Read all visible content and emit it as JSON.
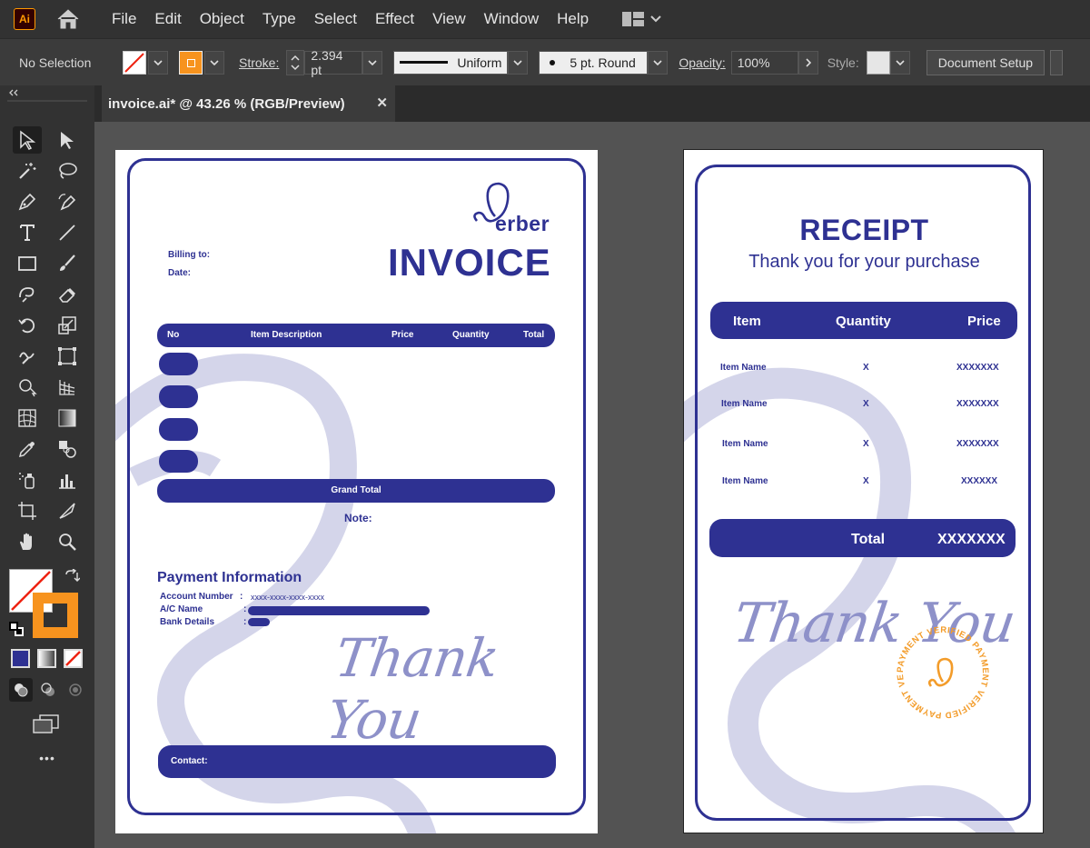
{
  "app": {
    "logo": "Ai",
    "home_icon": "home-icon",
    "accent": "#ff9a00"
  },
  "menu": [
    "File",
    "Edit",
    "Object",
    "Type",
    "Select",
    "Effect",
    "View",
    "Window",
    "Help"
  ],
  "control": {
    "selection": "No Selection",
    "stroke_label": "Stroke:",
    "stroke_value": "2.394 pt",
    "profile": "Uniform",
    "brush": "5 pt. Round",
    "opacity_label": "Opacity:",
    "opacity_value": "100%",
    "style_label": "Style:",
    "doc_setup": "Document Setup"
  },
  "tab": {
    "title": "invoice.ai* @ 43.26 % (RGB/Preview)",
    "close": "✕"
  },
  "tools_more": "•••",
  "invoice": {
    "brand": "erber",
    "brand_mark": "B",
    "title": "INVOICE",
    "billing": "Billing to:",
    "date": "Date:",
    "headers": [
      "No",
      "Item Description",
      "Price",
      "Quantity",
      "Total"
    ],
    "grand_total": "Grand Total",
    "note": "Note:",
    "payment_title": "Payment Information",
    "account_label": "Account Number",
    "account_colon": ":",
    "account_value": "xxxx-xxxx-xxxx-xxxx",
    "ac_name_label": "A/C Name",
    "bank_label": "Bank Details",
    "colon": ":",
    "thank": "Thank You",
    "contact": "Contact:"
  },
  "receipt": {
    "title": "RECEIPT",
    "subtitle": "Thank you for your purchase",
    "headers": [
      "Item",
      "Quantity",
      "Price"
    ],
    "rows": [
      {
        "item": "Item Name",
        "qty": "X",
        "price": "XXXXXXX"
      },
      {
        "item": "Item Name",
        "qty": "X",
        "price": "XXXXXXX"
      },
      {
        "item": "Item Name",
        "qty": "X",
        "price": "XXXXXXX"
      },
      {
        "item": "Item Name",
        "qty": "X",
        "price": "XXXXXX"
      }
    ],
    "total_label": "Total",
    "total_value": "XXXXXXX",
    "thank": "Thank You",
    "stamp_text": "PAYMENT VERIFIED  PAYMENT VERIFIED  PAYMENT VERIFIED ",
    "stamp_color": "#f39c2a"
  },
  "colors": {
    "navy": "#2e3192",
    "watermark": "#d4d5ea",
    "script": "#8e91c9"
  }
}
